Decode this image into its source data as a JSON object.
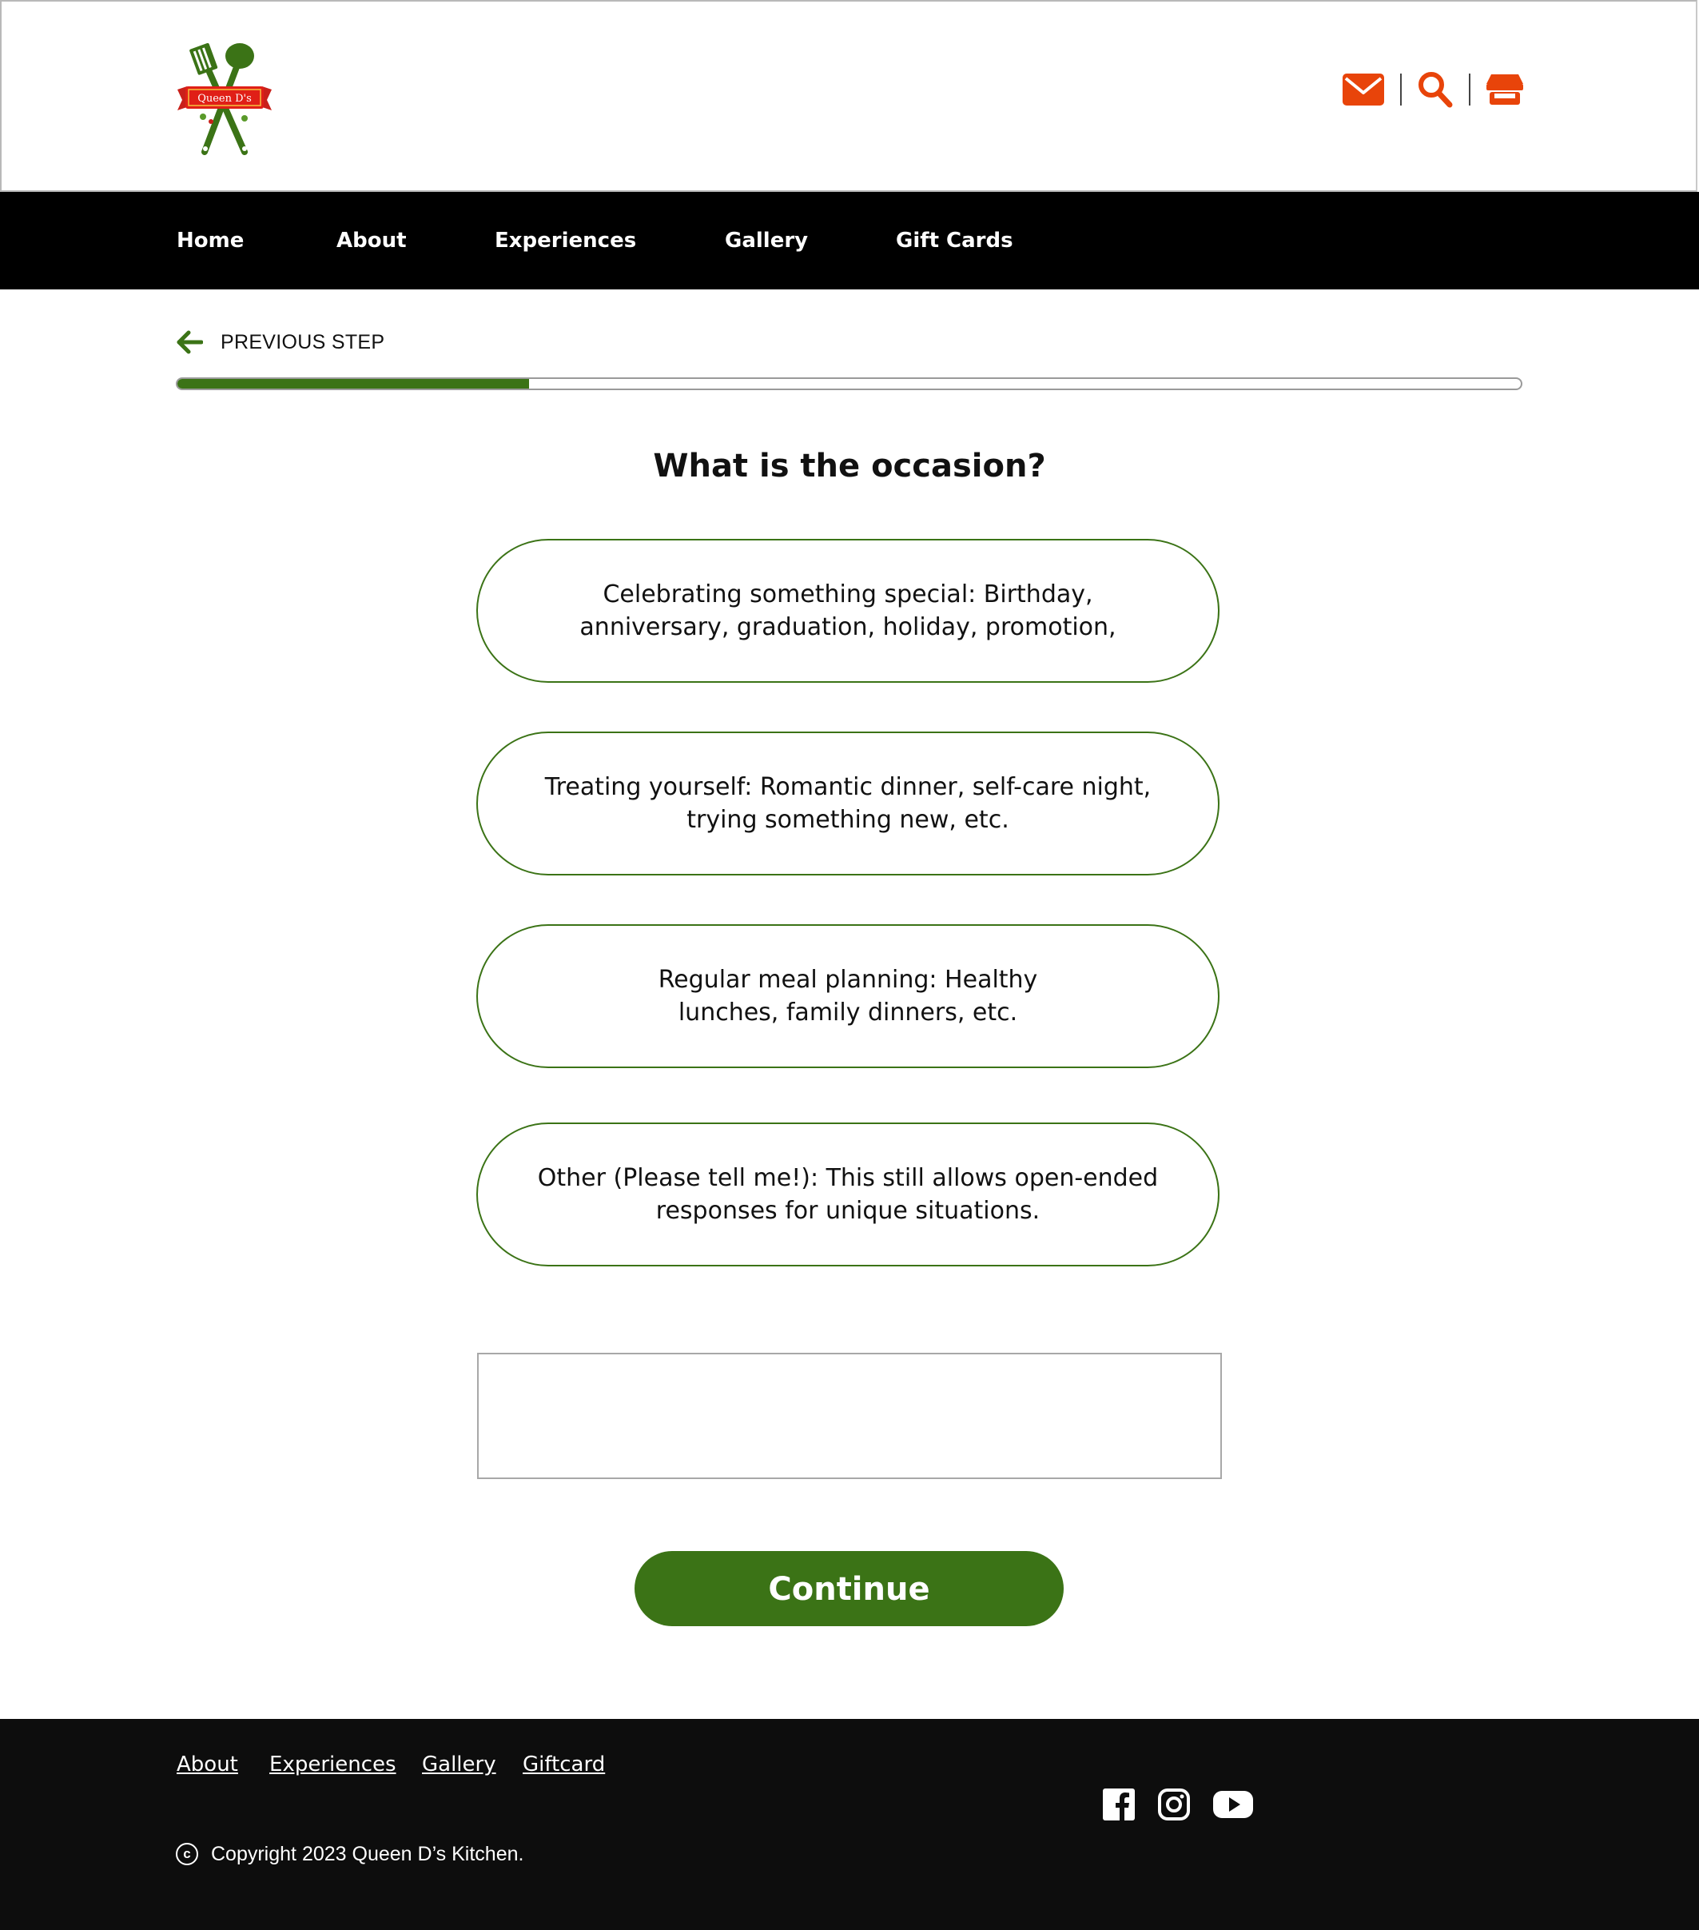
{
  "header": {
    "logo_text": "Queen D's",
    "icons": [
      "mail-icon",
      "search-icon",
      "store-icon"
    ],
    "accent_color": "#e8440a"
  },
  "nav": {
    "items": [
      {
        "label": "Home"
      },
      {
        "label": "About"
      },
      {
        "label": "Experiences"
      },
      {
        "label": "Gallery"
      },
      {
        "label": "Gift Cards"
      }
    ]
  },
  "wizard": {
    "previous_step_label": "PREVIOUS STEP",
    "progress_fraction": 0.262,
    "question": "What is the occasion?",
    "options": [
      {
        "label": "Celebrating something special: Birthday, anniversary, graduation, holiday, promotion,"
      },
      {
        "label": "Treating yourself: Romantic dinner, self-care night, trying something new, etc."
      },
      {
        "label": "Regular meal planning: Healthy lunches, family dinners, etc."
      },
      {
        "label": "Other (Please tell me!): This still allows open-ended responses for unique situations."
      }
    ],
    "other_text_value": "",
    "continue_label": "Continue",
    "brand_green": "#3b7316"
  },
  "footer": {
    "links": [
      {
        "label": "About"
      },
      {
        "label": "Experiences"
      },
      {
        "label": "Gallery"
      },
      {
        "label": "Giftcard"
      }
    ],
    "social_icons": [
      "facebook-icon",
      "instagram-icon",
      "youtube-icon"
    ],
    "copyright_symbol": "c",
    "copyright": "Copyright 2023 Queen D’s Kitchen."
  }
}
